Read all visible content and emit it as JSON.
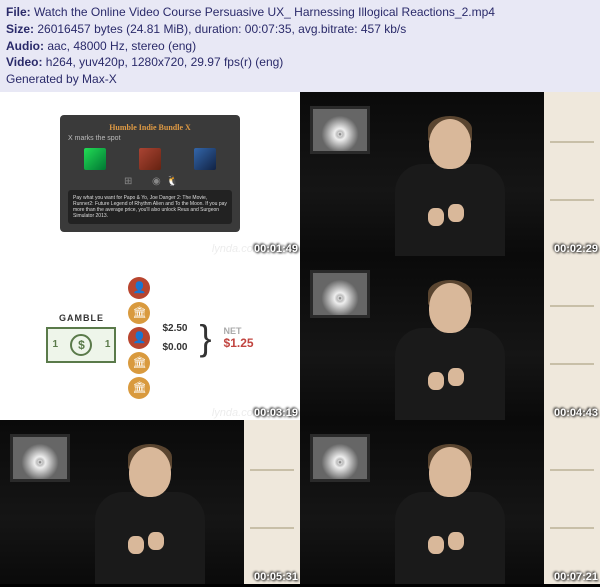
{
  "header": {
    "file_label": "File: ",
    "file": "Watch the Online Video Course Persuasive UX_ Harnessing Illogical Reactions_2.mp4",
    "size_label": "Size: ",
    "size": "26016457 bytes (24.81 MiB), duration: 00:07:35, avg.bitrate: 457 kb/s",
    "audio_label": "Audio: ",
    "audio": "aac, 48000 Hz, stereo (eng)",
    "video_label": "Video: ",
    "video": "h264, yuv420p, 1280x720, 29.97 fps(r) (eng)",
    "generated": "Generated by Max-X"
  },
  "thumbnails": {
    "ts1": "00:01:49",
    "ts2": "00:02:29",
    "ts3": "00:03:19",
    "ts4": "00:04:43",
    "ts5": "00:05:31",
    "ts6": "00:07:21",
    "watermark": "lynda.com"
  },
  "bundle": {
    "title": "Humble Indie Bundle X",
    "subtitle": "X marks the spot",
    "footer": "Pay what you want for Papo & Yo, Joe Danger 2: The Movie, Runner2: Future Legend of Rhythm Alien and To the Moon. If you pay more than the average price, you'll also unlock Reus and Surgeon Simulator 2013."
  },
  "gamble": {
    "label": "GAMBLE",
    "bill_left": "1",
    "bill_sym": "$",
    "bill_right": "1",
    "val1": "$2.50",
    "val2": "$0.00",
    "net_label": "NET",
    "net_value": "$1.25"
  }
}
